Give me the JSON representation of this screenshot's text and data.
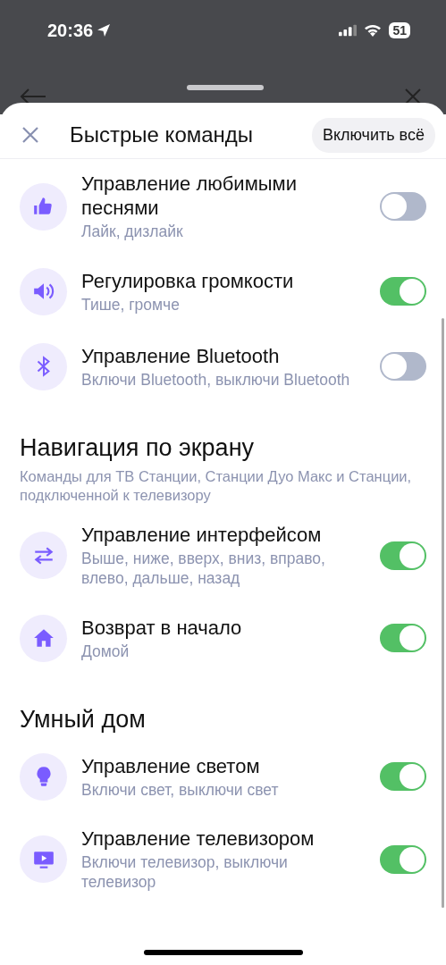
{
  "status_bar": {
    "time": "20:36",
    "battery": "51"
  },
  "header": {
    "title": "Быстрые команды",
    "action": "Включить всё"
  },
  "sections": [
    {
      "items": [
        {
          "kind": "like",
          "title": "Управление любимыми песнями",
          "subtitle": "Лайк, дизлайк",
          "on": false
        },
        {
          "kind": "volume",
          "title": "Регулировка громкости",
          "subtitle": "Тише, громче",
          "on": true
        },
        {
          "kind": "bluetooth",
          "title": "Управление Bluetooth",
          "subtitle": "Включи Bluetooth, выключи Bluetooth",
          "on": false
        }
      ]
    },
    {
      "title": "Навигация по экрану",
      "subtitle": "Команды для ТВ Станции, Станции Дуо Макс и Станции, подключенной к телевизору",
      "items": [
        {
          "kind": "arrows",
          "title": "Управление интерфейсом",
          "subtitle": "Выше, ниже, вверх, вниз, вправо, влево, дальше, назад",
          "on": true
        },
        {
          "kind": "home",
          "title": "Возврат в начало",
          "subtitle": "Домой",
          "on": true
        }
      ]
    },
    {
      "title": "Умный дом",
      "items": [
        {
          "kind": "bulb",
          "title": "Управление светом",
          "subtitle": "Включи свет, выключи свет",
          "on": true
        },
        {
          "kind": "tv",
          "title": "Управление телевизором",
          "subtitle": "Включи телевизор, выключи телевизор",
          "on": true
        }
      ]
    }
  ]
}
